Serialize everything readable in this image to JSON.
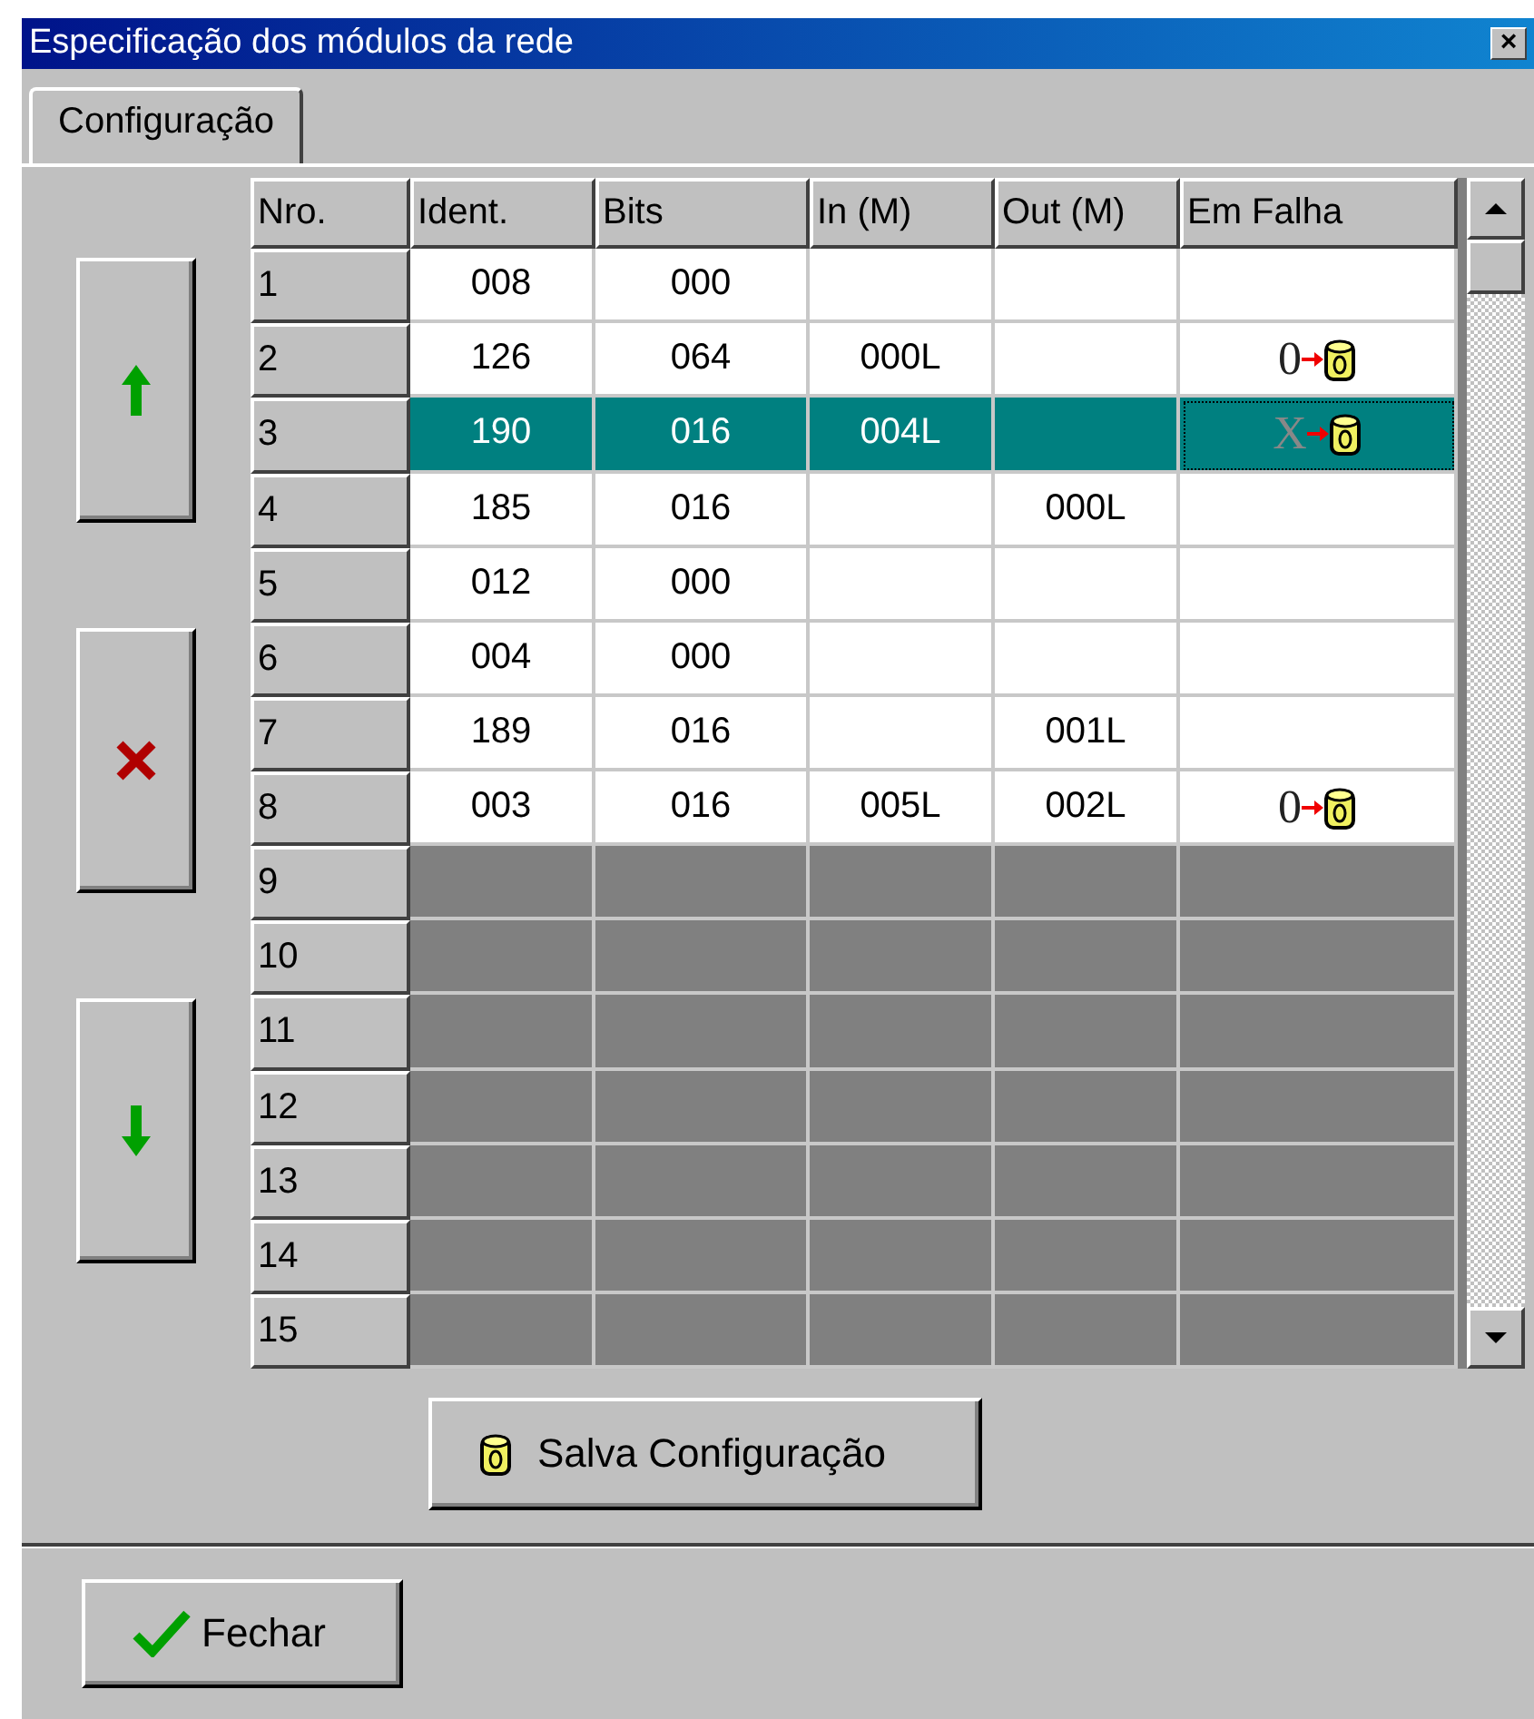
{
  "window": {
    "title": "Especificação dos módulos da rede",
    "close": "×"
  },
  "tabs": [
    {
      "label": "Configuração",
      "selected": true
    }
  ],
  "side_buttons": [
    {
      "kind": "up"
    },
    {
      "kind": "delete"
    },
    {
      "kind": "down"
    }
  ],
  "table": {
    "columns": [
      "Nro.",
      "Ident.",
      "Bits",
      "In (M)",
      "Out (M)",
      "Em Falha"
    ],
    "rows": [
      {
        "nro": "1",
        "used": true,
        "selected": false,
        "ident": "008",
        "bits": "000",
        "in": "",
        "out": "",
        "fault": ""
      },
      {
        "nro": "2",
        "used": true,
        "selected": false,
        "ident": "126",
        "bits": "064",
        "in": "000L",
        "out": "",
        "fault": "0"
      },
      {
        "nro": "3",
        "used": true,
        "selected": true,
        "ident": "190",
        "bits": "016",
        "in": "004L",
        "out": "",
        "fault": "X"
      },
      {
        "nro": "4",
        "used": true,
        "selected": false,
        "ident": "185",
        "bits": "016",
        "in": "",
        "out": "000L",
        "fault": ""
      },
      {
        "nro": "5",
        "used": true,
        "selected": false,
        "ident": "012",
        "bits": "000",
        "in": "",
        "out": "",
        "fault": ""
      },
      {
        "nro": "6",
        "used": true,
        "selected": false,
        "ident": "004",
        "bits": "000",
        "in": "",
        "out": "",
        "fault": ""
      },
      {
        "nro": "7",
        "used": true,
        "selected": false,
        "ident": "189",
        "bits": "016",
        "in": "",
        "out": "001L",
        "fault": ""
      },
      {
        "nro": "8",
        "used": true,
        "selected": false,
        "ident": "003",
        "bits": "016",
        "in": "005L",
        "out": "002L",
        "fault": "0"
      },
      {
        "nro": "9",
        "used": false,
        "selected": false
      },
      {
        "nro": "10",
        "used": false,
        "selected": false
      },
      {
        "nro": "11",
        "used": false,
        "selected": false
      },
      {
        "nro": "12",
        "used": false,
        "selected": false
      },
      {
        "nro": "13",
        "used": false,
        "selected": false
      },
      {
        "nro": "14",
        "used": false,
        "selected": false
      },
      {
        "nro": "15",
        "used": false,
        "selected": false
      }
    ]
  },
  "save_button": {
    "label": "Salva Configuração"
  },
  "close_button": {
    "label": "Fechar"
  }
}
